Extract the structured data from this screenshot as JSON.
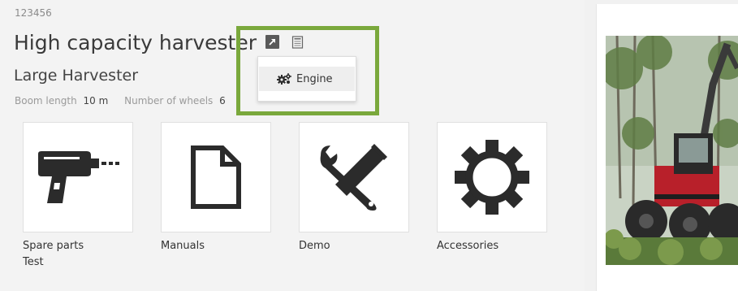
{
  "product": {
    "id": "123456",
    "title": "High capacity harvester",
    "subtitle": "Large Harvester",
    "specs": [
      {
        "label": "Boom length",
        "value": "10 m"
      },
      {
        "label": "Number of wheels",
        "value": "6"
      }
    ]
  },
  "title_icons": [
    "external-link-icon",
    "document-list-icon"
  ],
  "dropdown": {
    "items": [
      {
        "label": "Engine",
        "icon": "gears-icon"
      }
    ]
  },
  "tiles": [
    {
      "label": "Spare parts",
      "sub": "Test",
      "icon": "drill-icon"
    },
    {
      "label": "Manuals",
      "sub": "",
      "icon": "document-icon"
    },
    {
      "label": "Demo",
      "sub": "",
      "icon": "tools-icon"
    },
    {
      "label": "Accessories",
      "sub": "",
      "icon": "cog-icon"
    }
  ],
  "colors": {
    "highlight": "#7aa83c",
    "machine_red": "#b8202a",
    "icon_dark": "#2b2b2b"
  }
}
